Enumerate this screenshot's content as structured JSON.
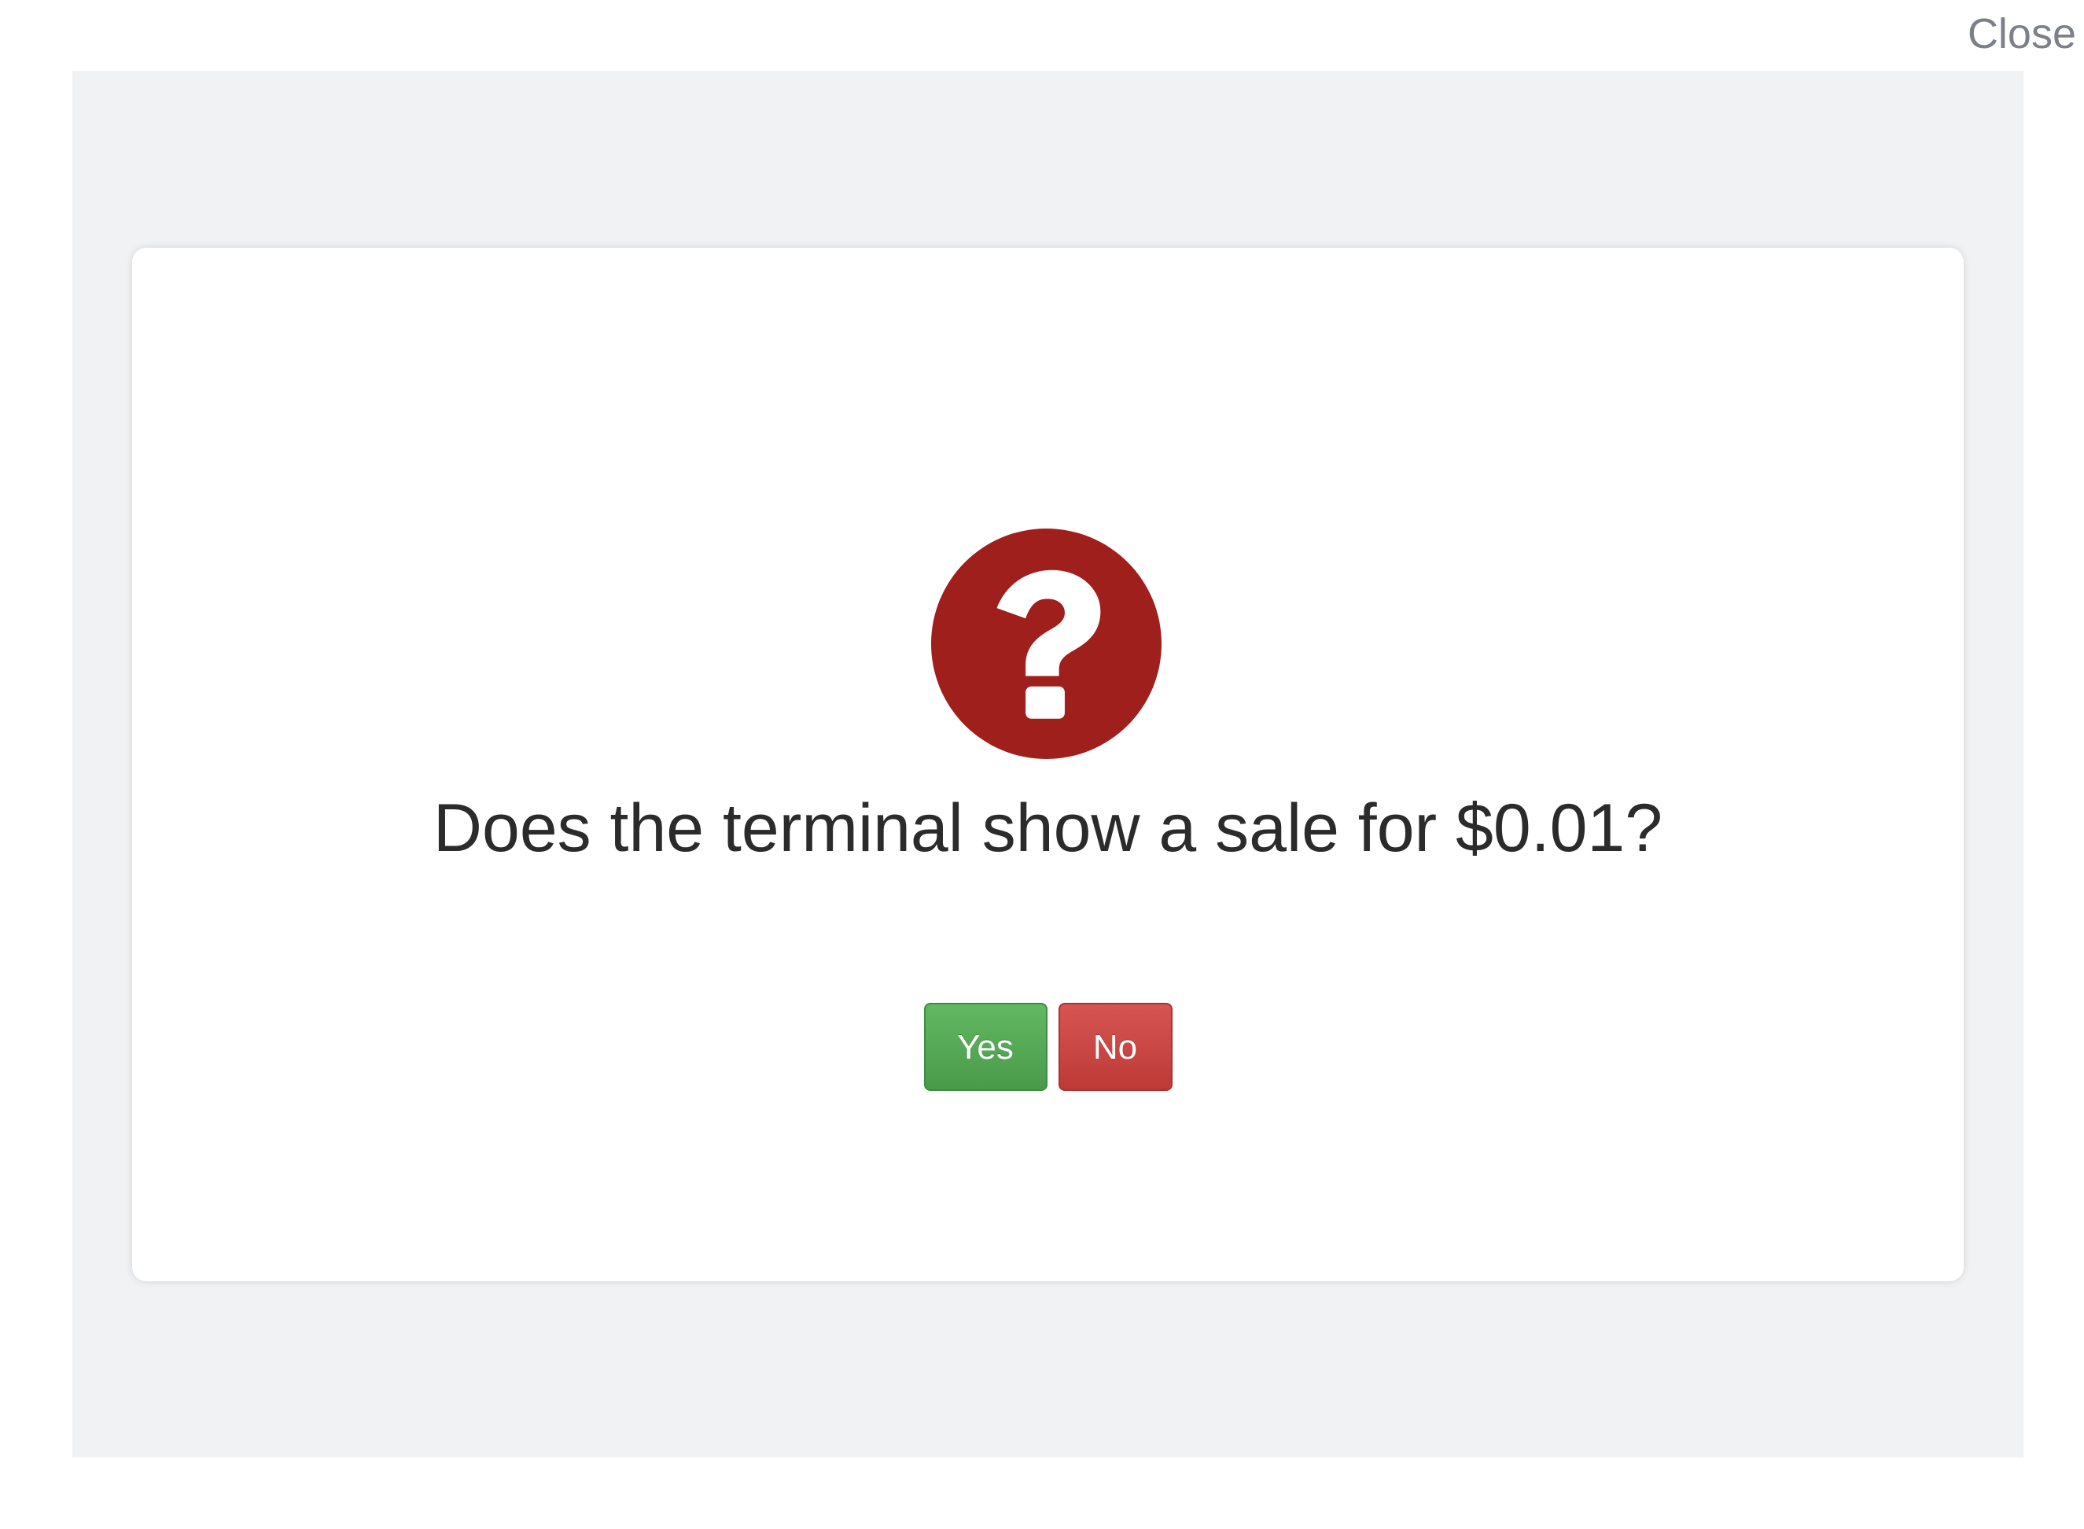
{
  "header": {
    "close_label": "Close"
  },
  "dialog": {
    "icon": "question-circle-icon",
    "prompt": "Does the terminal show a sale for $0.01?",
    "yes_label": "Yes",
    "no_label": "No"
  },
  "colors": {
    "icon_red": "#9e1f1c",
    "yes_green": "#55a655",
    "no_red": "#c9413e",
    "backdrop": "#f1f2f4",
    "close_text": "#7b8089"
  }
}
